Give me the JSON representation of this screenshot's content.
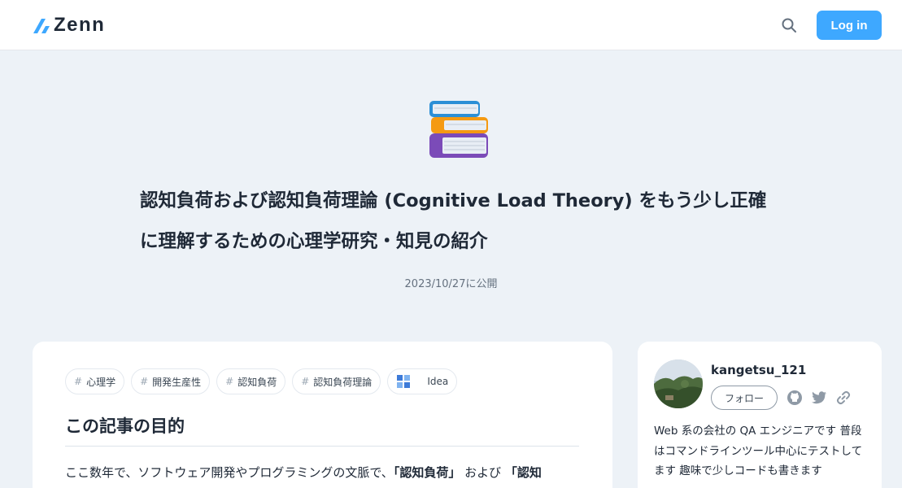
{
  "header": {
    "logo_text": "Zenn",
    "search_icon": "search-icon",
    "login_label": "Log in",
    "accent_color": "#3ea8ff"
  },
  "hero": {
    "emoji_icon": "books-emoji",
    "title": "認知負荷および認知負荷理論 (Cognitive Load Theory) をもう少し正確に理解するための心理学研究・知見の紹介",
    "published": "2023/10/27に公開"
  },
  "article": {
    "topics": [
      {
        "label": "心理学",
        "icon": "hash-icon"
      },
      {
        "label": "開発生産性",
        "icon": "hash-icon"
      },
      {
        "label": "認知負荷",
        "icon": "hash-icon"
      },
      {
        "label": "認知負荷理論",
        "icon": "hash-icon"
      },
      {
        "label": "Idea",
        "icon": "idea-icon"
      }
    ],
    "section_title": "この記事の目的",
    "intro": {
      "p1": "ここ数年で、ソフトウェア開発やプログラミングの文脈で、",
      "b1": "「認知負荷」",
      "p2": " および ",
      "b2": "「認知"
    }
  },
  "author": {
    "name": "kangetsu_121",
    "follow_label": "フォロー",
    "social_icons": [
      "github-icon",
      "twitter-icon",
      "link-icon"
    ],
    "bio": "Web 系の会社の QA エンジニアです 普段はコマンドラインツール中心にテストしてます 趣味で少しコードも書きます"
  }
}
